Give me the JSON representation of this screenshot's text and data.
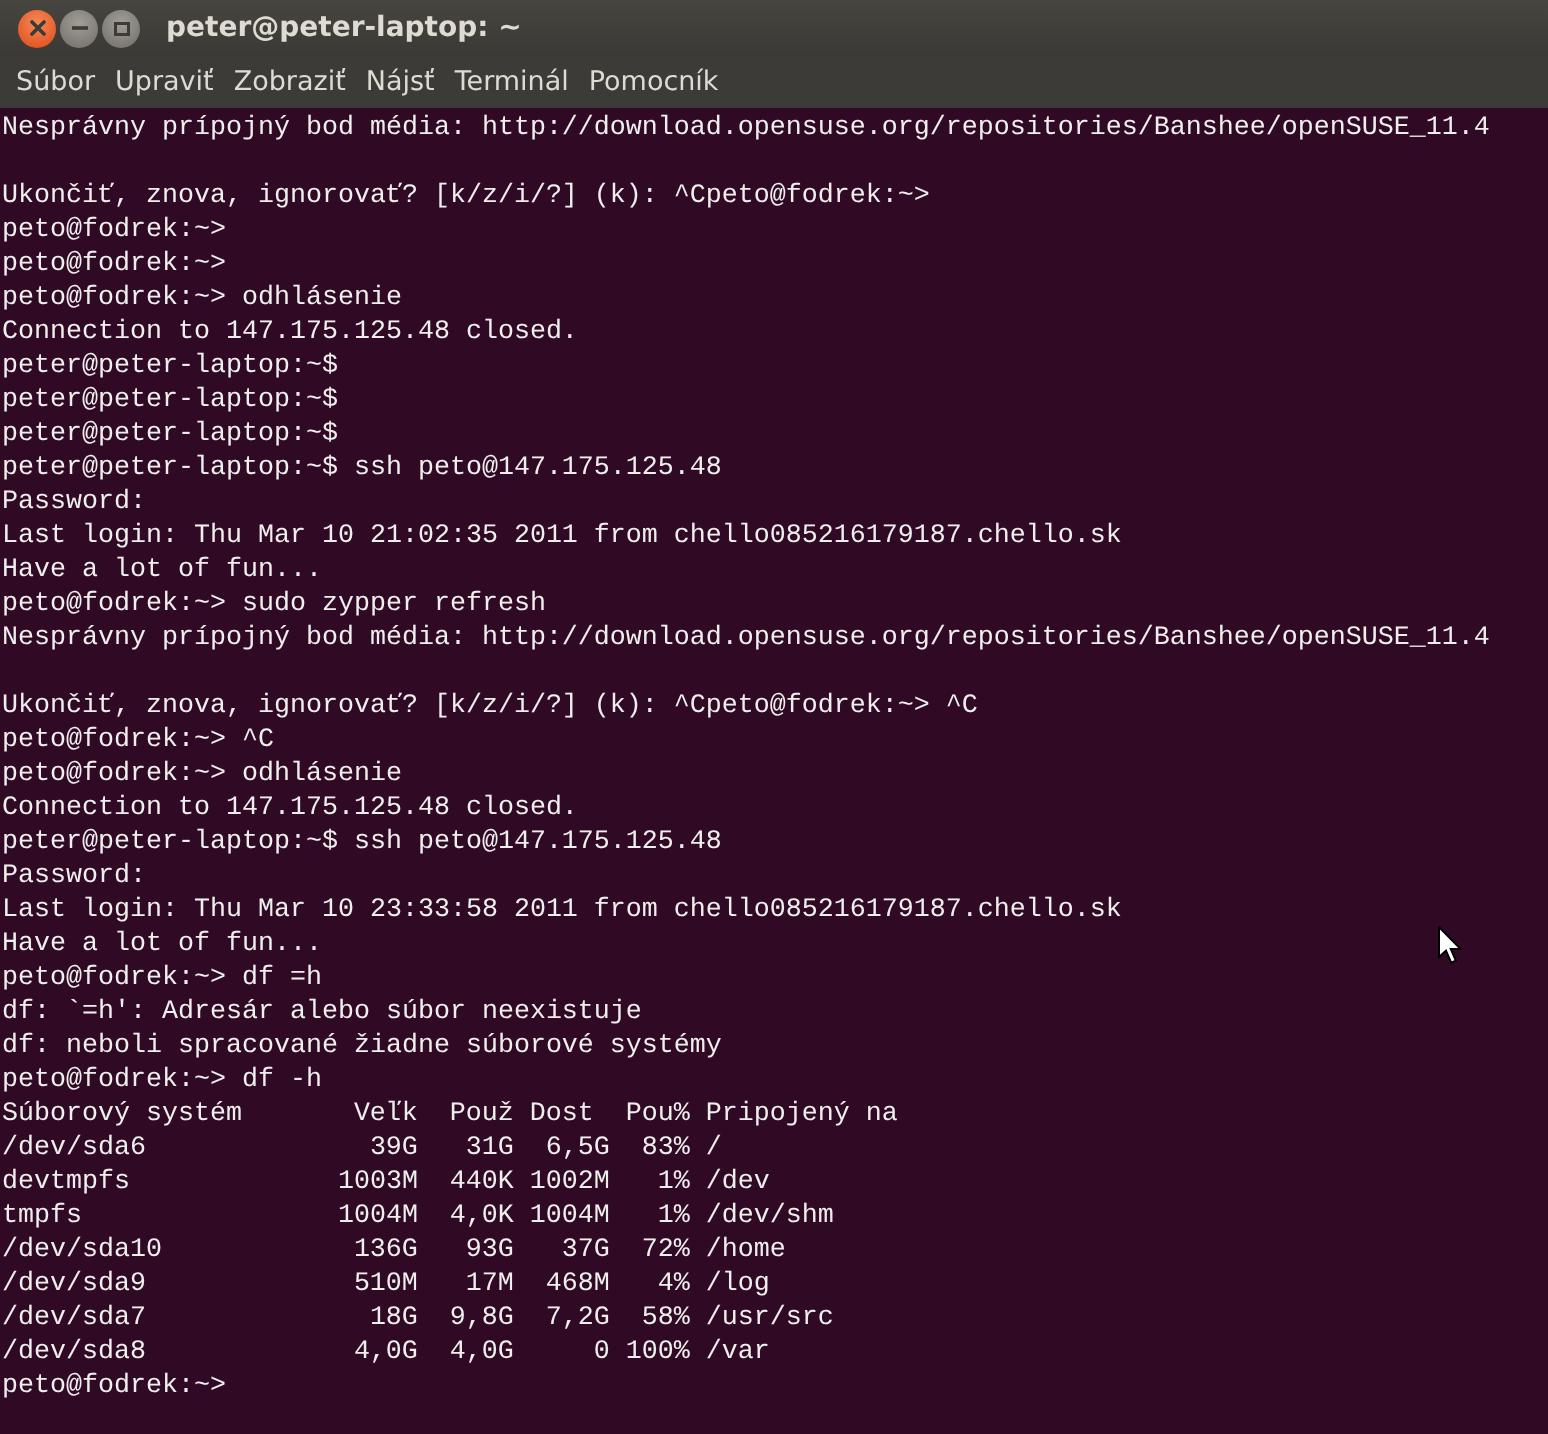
{
  "window": {
    "title": "peter@peter-laptop: ~"
  },
  "menu": [
    "Súbor",
    "Upraviť",
    "Zobraziť",
    "Nájsť",
    "Terminál",
    "Pomocník"
  ],
  "terminal": {
    "lines": [
      {
        "text": "Nesprávny prípojný bod média: http://download.opensuse.org/repositories/Banshee/openSUSE_11.4"
      },
      {
        "kind": "blank"
      },
      {
        "text": "Ukončiť, znova, ignorovať? [k/z/i/?] (k): ^Cpeto@fodrek:~>"
      },
      {
        "text": "peto@fodrek:~>"
      },
      {
        "text": "peto@fodrek:~>"
      },
      {
        "text": "peto@fodrek:~> odhlásenie"
      },
      {
        "text": "Connection to 147.175.125.48 closed."
      },
      {
        "text": "peter@peter-laptop:~$"
      },
      {
        "text": "peter@peter-laptop:~$"
      },
      {
        "text": "peter@peter-laptop:~$"
      },
      {
        "text": "peter@peter-laptop:~$ ssh peto@147.175.125.48"
      },
      {
        "text": "Password:"
      },
      {
        "text": "Last login: Thu Mar 10 21:02:35 2011 from chello085216179187.chello.sk"
      },
      {
        "text": "Have a lot of fun..."
      },
      {
        "text": "peto@fodrek:~> sudo zypper refresh"
      },
      {
        "text": "Nesprávny prípojný bod média: http://download.opensuse.org/repositories/Banshee/openSUSE_11.4"
      },
      {
        "kind": "blank"
      },
      {
        "text": "Ukončiť, znova, ignorovať? [k/z/i/?] (k): ^Cpeto@fodrek:~> ^C"
      },
      {
        "text": "peto@fodrek:~> ^C"
      },
      {
        "text": "peto@fodrek:~> odhlásenie"
      },
      {
        "text": "Connection to 147.175.125.48 closed."
      },
      {
        "text": "peter@peter-laptop:~$ ssh peto@147.175.125.48"
      },
      {
        "text": "Password:"
      },
      {
        "text": "Last login: Thu Mar 10 23:33:58 2011 from chello085216179187.chello.sk"
      },
      {
        "text": "Have a lot of fun..."
      },
      {
        "text": "peto@fodrek:~> df =h"
      },
      {
        "text": "df: `=h': Adresár alebo súbor neexistuje"
      },
      {
        "text": "df: neboli spracované žiadne súborové systémy"
      },
      {
        "text": "peto@fodrek:~> df -h"
      }
    ],
    "df_table": {
      "columns": [
        "Súborový systém",
        "Veľk",
        "Použ",
        "Dost",
        "Pou%",
        "Pripojený na"
      ],
      "rows": [
        [
          "/dev/sda6",
          "39G",
          "31G",
          "6,5G",
          "83%",
          "/"
        ],
        [
          "devtmpfs",
          "1003M",
          "440K",
          "1002M",
          "1%",
          "/dev"
        ],
        [
          "tmpfs",
          "1004M",
          "4,0K",
          "1004M",
          "1%",
          "/dev/shm"
        ],
        [
          "/dev/sda10",
          "136G",
          "93G",
          "37G",
          "72%",
          "/home"
        ],
        [
          "/dev/sda9",
          "510M",
          "17M",
          "468M",
          "4%",
          "/log"
        ],
        [
          "/dev/sda7",
          "18G",
          "9,8G",
          "7,2G",
          "58%",
          "/usr/src"
        ],
        [
          "/dev/sda8",
          "4,0G",
          "4,0G",
          "0",
          "100%",
          "/var"
        ]
      ]
    },
    "last_line": "peto@fodrek:~>"
  }
}
